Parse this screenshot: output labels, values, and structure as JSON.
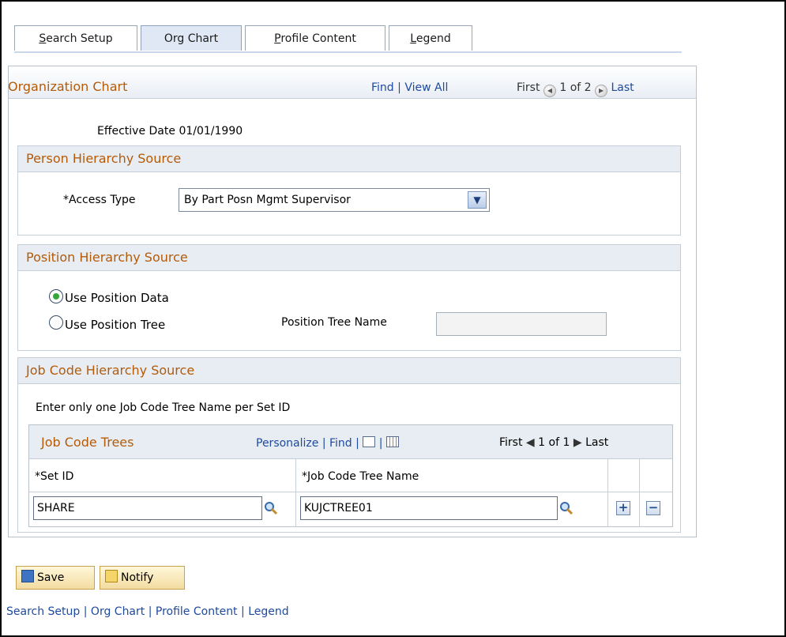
{
  "tabs": [
    {
      "label_u": "S",
      "label_rest": "earch Setup"
    },
    {
      "label_u": "",
      "label_rest": "Org Chart"
    },
    {
      "label_u": "P",
      "label_rest": "rofile Content"
    },
    {
      "label_u": "L",
      "label_rest": "egend"
    }
  ],
  "org_chart": {
    "title": "Organization Chart",
    "find": "Find",
    "view_all": "View All",
    "first": "First",
    "page_status": "1 of 2",
    "last": "Last",
    "effective_date_label": "Effective Date",
    "effective_date_value": "01/01/1990"
  },
  "person_hierarchy": {
    "title": "Person Hierarchy Source",
    "access_type_label": "*Access Type",
    "access_type_value": "By Part Posn Mgmt Supervisor"
  },
  "position_hierarchy": {
    "title": "Position Hierarchy Source",
    "use_position_data": "Use Position Data",
    "use_position_tree": "Use Position Tree",
    "position_tree_name_label": "Position Tree Name",
    "position_tree_name_value": ""
  },
  "job_code": {
    "title": "Job Code Hierarchy Source",
    "instruction": "Enter only one Job Code Tree Name per Set ID",
    "grid_title": "Job Code Trees",
    "personalize": "Personalize",
    "find": "Find",
    "first": "First",
    "page_status": "1 of 1",
    "last": "Last",
    "col_setid": "*Set ID",
    "col_tree": "*Job Code Tree Name",
    "row_setid": "SHARE",
    "row_tree": "KUJCTREE01"
  },
  "buttons": {
    "save": "Save",
    "notify": "Notify"
  },
  "footer_links": [
    "Search Setup",
    "Org Chart",
    "Profile Content",
    "Legend"
  ],
  "colors": {
    "accent_orange": "#b35b09",
    "link_blue": "#1e4aa0",
    "section_bg": "#e8edf3",
    "radio_selected": "#34a93a"
  }
}
